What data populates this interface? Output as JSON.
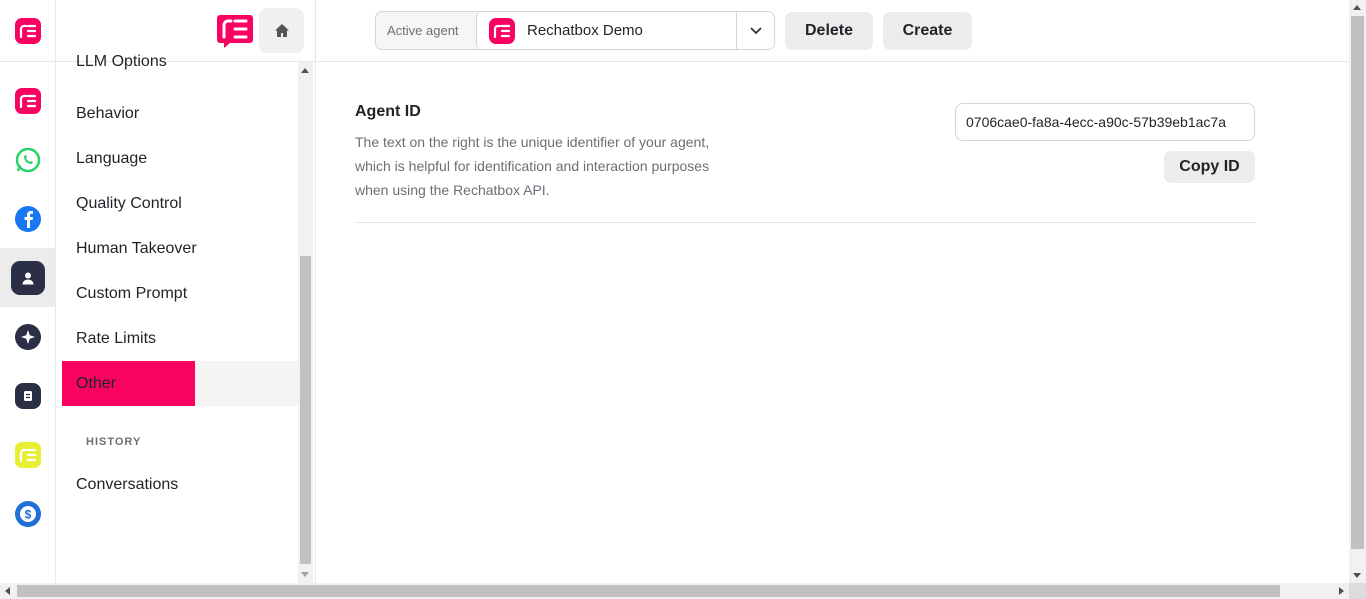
{
  "rail": {
    "items": [
      {
        "icon": "rechatbox-logo-icon",
        "color": "#f90262"
      },
      {
        "icon": "whatsapp-icon",
        "color": "#25d366"
      },
      {
        "icon": "facebook-icon",
        "color": "#1877f2"
      },
      {
        "icon": "agent-person-icon",
        "color": "#2a2f45",
        "active": true
      },
      {
        "icon": "sparkle-icon",
        "color": "#2a2f45"
      },
      {
        "icon": "document-icon",
        "color": "#2a2f45"
      },
      {
        "icon": "rechatbox-yellow-logo-icon",
        "color": "#e8ee32"
      },
      {
        "icon": "billing-dollar-icon",
        "color": "#1f6fd6"
      }
    ]
  },
  "menu": {
    "items": [
      {
        "label": "LLM Options"
      },
      {
        "label": "Behavior"
      },
      {
        "label": "Language"
      },
      {
        "label": "Quality Control"
      },
      {
        "label": "Human Takeover"
      },
      {
        "label": "Custom Prompt"
      },
      {
        "label": "Rate Limits"
      },
      {
        "label": "Other",
        "selected": true
      }
    ],
    "history_section": "HISTORY",
    "history_items": [
      {
        "label": "Conversations"
      }
    ]
  },
  "header": {
    "active_agent_label": "Active agent",
    "active_agent_value": "Rechatbox Demo",
    "delete_label": "Delete",
    "create_label": "Create"
  },
  "main": {
    "agent_id_title": "Agent ID",
    "agent_id_description": "The text on the right is the unique identifier of your agent, which is helpful for identification and interaction purposes when using the Rechatbox API.",
    "agent_id_value": "0706cae0-fa8a-4ecc-a90c-57b39eb1ac7a",
    "copy_label": "Copy ID"
  },
  "colors": {
    "brand": "#f90262",
    "selected_bg": "#f90262"
  }
}
